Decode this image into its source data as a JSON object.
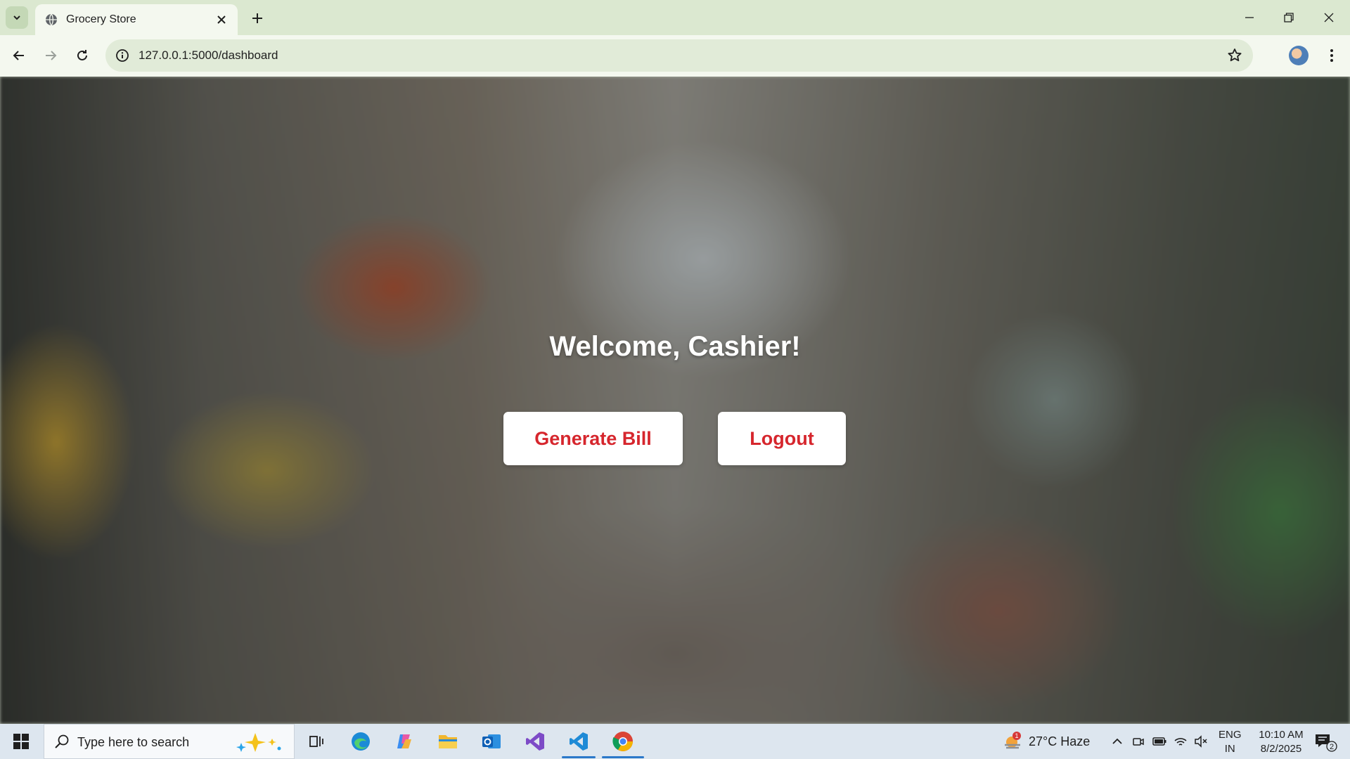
{
  "browser": {
    "tab_title": "Grocery Store",
    "url": "127.0.0.1:5000/dashboard"
  },
  "page": {
    "welcome": "Welcome, Cashier!",
    "generate_bill_label": "Generate Bill",
    "logout_label": "Logout",
    "accent_color": "#d6262d"
  },
  "taskbar": {
    "search_placeholder": "Type here to search",
    "weather_text": "27°C  Haze",
    "weather_badge": "1",
    "lang_line1": "ENG",
    "lang_line2": "IN",
    "time": "10:10 AM",
    "date": "8/2/2025",
    "notification_count": "2",
    "pinned_apps": [
      "task-view",
      "edge",
      "copilot",
      "file-explorer",
      "outlook",
      "visual-studio",
      "vs-code",
      "chrome"
    ]
  }
}
